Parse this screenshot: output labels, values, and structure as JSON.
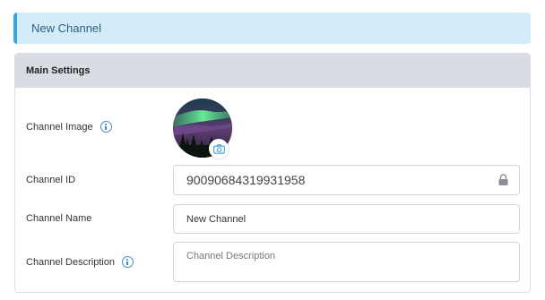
{
  "header": {
    "title": "New Channel"
  },
  "panel": {
    "title": "Main Settings"
  },
  "form": {
    "image_label": "Channel Image",
    "id_label": "Channel ID",
    "id_value": "90090684319931958",
    "name_label": "Channel Name",
    "name_value": "New Channel",
    "description_label": "Channel Description",
    "description_placeholder": "Channel Description"
  },
  "colors": {
    "accent": "#36a9e1",
    "header_bg": "#d2ecf9",
    "panel_head_bg": "#d9dce2",
    "info_icon": "#3d8ad4"
  }
}
